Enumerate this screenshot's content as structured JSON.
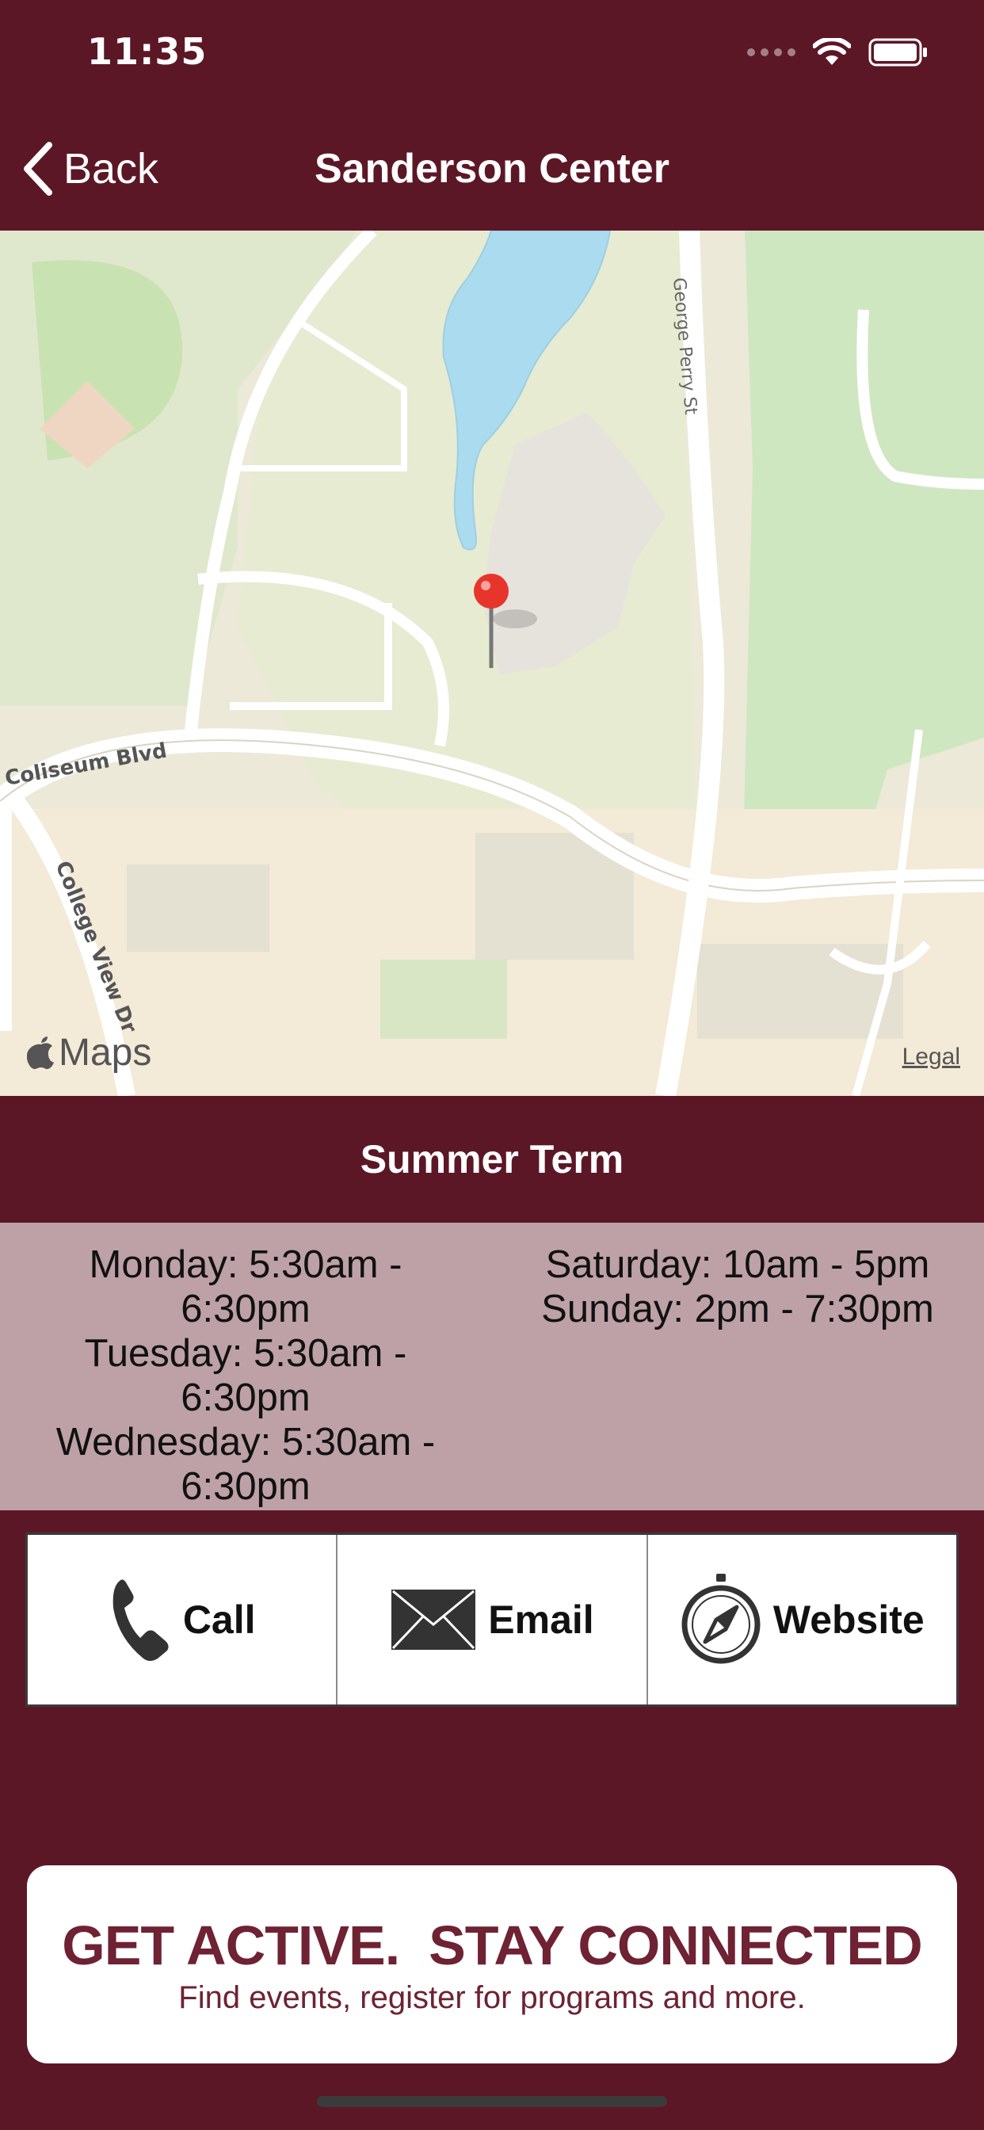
{
  "status_bar": {
    "time": "11:35"
  },
  "nav": {
    "back_label": "Back",
    "title": "Sanderson Center"
  },
  "map": {
    "street_labels": [
      "Coliseum Blvd",
      "George Perry St",
      "College View Dr"
    ],
    "maps_label": "Maps",
    "legal_label": "Legal"
  },
  "term": {
    "title": "Summer Term"
  },
  "hours": {
    "left": [
      "Monday: 5:30am -",
      "6:30pm",
      "Tuesday: 5:30am -",
      "6:30pm",
      "Wednesday: 5:30am -",
      "6:30pm"
    ],
    "right": [
      "Saturday: 10am - 5pm",
      "Sunday: 2pm - 7:30pm"
    ]
  },
  "actions": {
    "call_label": "Call",
    "email_label": "Email",
    "website_label": "Website"
  },
  "banner": {
    "headline": "GET ACTIVE.  STAY CONNECTED",
    "subtitle": "Find events, register for programs and more."
  },
  "colors": {
    "brand": "#5c1726",
    "hours_bg": "#bda1a7",
    "banner_text": "#6e2234"
  },
  "icons": [
    "back-chevron-icon",
    "wifi-icon",
    "battery-icon",
    "map-pin-icon",
    "phone-icon",
    "mail-icon",
    "compass-icon",
    "apple-logo-icon"
  ]
}
